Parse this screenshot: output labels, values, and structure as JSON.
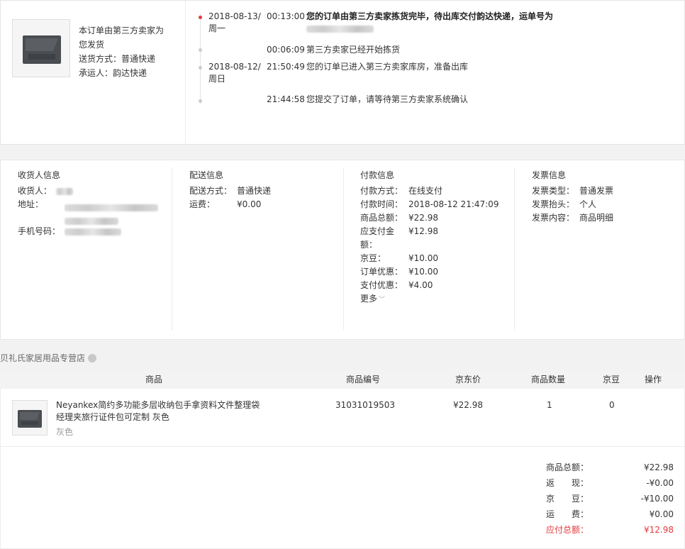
{
  "shipment": {
    "line1": "本订单由第三方卖家为",
    "line2": "您发货",
    "method_label": "送货方式：",
    "method": "普通快递",
    "carrier_label": "承运人：",
    "carrier": "韵达快递"
  },
  "timeline": [
    {
      "date": "2018-08-13/",
      "weekday": "周一",
      "time": "00:13:00",
      "text": "您的订单由第三方卖家拣货完毕，待出库交付韵达快递，运单号为"
    },
    {
      "date": "",
      "weekday": "",
      "time": "00:06:09",
      "text": "第三方卖家已经开始拣货"
    },
    {
      "date": "2018-08-12/",
      "weekday": "周日",
      "time": "21:50:49",
      "text": "您的订单已进入第三方卖家库房，准备出库"
    },
    {
      "date": "",
      "weekday": "",
      "time": "21:44:58",
      "text": "您提交了订单，请等待第三方卖家系统确认"
    }
  ],
  "consignee": {
    "title": "收货人信息",
    "name_label": "收货人：",
    "address_label": "地址：",
    "phone_label": "手机号码："
  },
  "delivery": {
    "title": "配送信息",
    "method_label": "配送方式：",
    "method": "普通快递",
    "fee_label": "运费：",
    "fee": "¥0.00"
  },
  "payment": {
    "title": "付款信息",
    "rows": [
      {
        "k": "付款方式：",
        "v": "在线支付"
      },
      {
        "k": "付款时间：",
        "v": "2018-08-12 21:47:09"
      },
      {
        "k": "商品总额：",
        "v": "¥22.98"
      },
      {
        "k": "应支付金",
        "v": "¥12.98"
      },
      {
        "k": "额：",
        "v": ""
      },
      {
        "k": "京豆：",
        "v": "¥10.00"
      },
      {
        "k": "订单优惠：",
        "v": "¥10.00"
      },
      {
        "k": "支付优惠：",
        "v": "¥4.00"
      }
    ],
    "more_label": "更多"
  },
  "invoice": {
    "title": "发票信息",
    "rows": [
      {
        "k": "发票类型：",
        "v": "普通发票"
      },
      {
        "k": "发票抬头：",
        "v": "个人"
      },
      {
        "k": "发票内容：",
        "v": "商品明细"
      }
    ]
  },
  "store": {
    "name": "贝礼氏家居用品专营店"
  },
  "product_table": {
    "headers": {
      "product": "商品",
      "sku": "商品编号",
      "price": "京东价",
      "qty": "商品数量",
      "beans": "京豆",
      "action": "操作"
    },
    "items": [
      {
        "name": "Neyankex简约多功能多层收纳包手拿资料文件整理袋经理夹旅行证件包可定制 灰色",
        "color": "灰色",
        "sku": "31031019503",
        "price": "¥22.98",
        "qty": "1",
        "beans": "0"
      }
    ]
  },
  "summary": [
    {
      "k": "商品总额：",
      "v": "¥22.98"
    },
    {
      "k": "返　　现：",
      "v": "-¥0.00"
    },
    {
      "k": "京　　豆：",
      "v": "-¥10.00"
    },
    {
      "k": "运　　费：",
      "v": "¥0.00"
    },
    {
      "k": "应付总额：",
      "v": "¥12.98"
    }
  ],
  "colors": {
    "accent": "#e4393c",
    "border": "#e6e6e6",
    "header_bg": "#f3f3f3"
  }
}
